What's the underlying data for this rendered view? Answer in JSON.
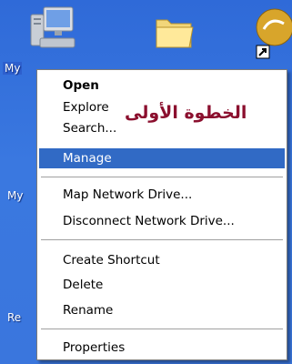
{
  "desktop": {
    "icons": [
      {
        "name": "my-computer",
        "label": "My"
      },
      {
        "name": "folder",
        "label": ""
      },
      {
        "name": "shortcut",
        "label": ""
      }
    ],
    "side_labels": {
      "my_documents_partial": "My",
      "recycle_partial": "Re"
    }
  },
  "context_menu": {
    "items": [
      {
        "label": "Open",
        "bold": true
      },
      {
        "label": "Explore"
      },
      {
        "label": "Search..."
      },
      {
        "label": "Manage",
        "highlighted": true
      },
      {
        "label": "Map Network Drive..."
      },
      {
        "label": "Disconnect Network Drive..."
      },
      {
        "label": "Create Shortcut"
      },
      {
        "label": "Delete"
      },
      {
        "label": "Rename"
      },
      {
        "label": "Properties"
      }
    ],
    "annotation": "الخطوة الأولى"
  },
  "colors": {
    "desktop_blue": "#3a76dd",
    "menu_highlight": "#316ac5",
    "annotation_red": "#8b0f2e"
  }
}
